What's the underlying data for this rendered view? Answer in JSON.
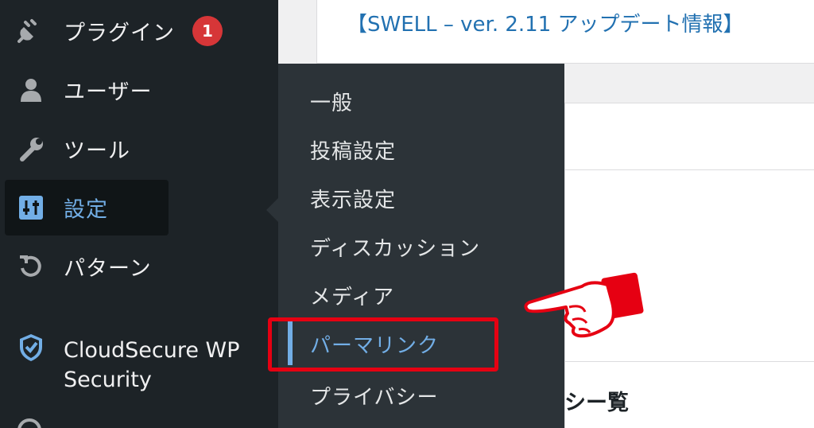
{
  "sidebar": {
    "items": [
      {
        "label": "プラグイン",
        "icon": "plugin-icon",
        "badge": "1"
      },
      {
        "label": "ユーザー",
        "icon": "user-icon"
      },
      {
        "label": "ツール",
        "icon": "wrench-icon"
      },
      {
        "label": "設定",
        "icon": "settings-sliders-icon",
        "active": true
      },
      {
        "label": "パターン",
        "icon": "refresh-icon"
      },
      {
        "label": "CloudSecure WP Security",
        "icon": "shield-check-icon"
      }
    ]
  },
  "submenu": {
    "items": [
      {
        "label": "一般"
      },
      {
        "label": "投稿設定"
      },
      {
        "label": "表示設定"
      },
      {
        "label": "ディスカッション"
      },
      {
        "label": "メディア"
      },
      {
        "label": "パーマリンク",
        "current": true
      },
      {
        "label": "プライバシー"
      }
    ]
  },
  "main": {
    "link": "【SWELL – ver. 2.11 アップデート情報】",
    "list_heading": "シー覧"
  },
  "colors": {
    "sidebar_bg": "#1d2327",
    "submenu_bg": "#2c3338",
    "accent": "#72aee6",
    "badge": "#d63638",
    "highlight": "#e60012",
    "link": "#2271b1"
  },
  "annotation": {
    "icon": "pointing-hand-icon"
  }
}
